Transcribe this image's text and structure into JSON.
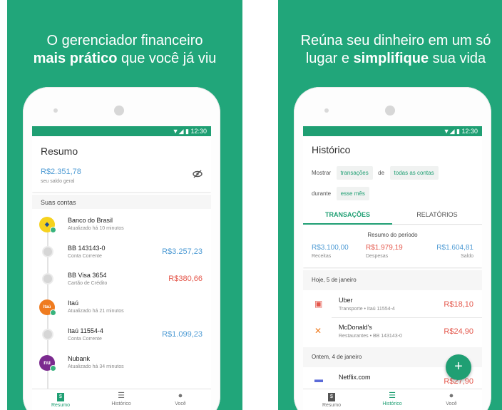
{
  "status_time": "12:30",
  "panel1": {
    "headline_line1": "O gerenciador financeiro",
    "headline_bold": "mais prático",
    "headline_rest": " que você já viu",
    "title": "Resumo",
    "balance": "R$2.351,78",
    "balance_label": "seu saldo geral",
    "section_title": "Suas contas",
    "accounts": [
      {
        "name": "Banco do Brasil",
        "sub": "Atualizado há 10 minutos",
        "amount": ""
      },
      {
        "name": "BB 143143-0",
        "sub": "Conta Corrente",
        "amount": "R$3.257,23"
      },
      {
        "name": "BB Visa 3654",
        "sub": "Cartão de Crédito",
        "amount": "R$380,66"
      },
      {
        "name": "Itaú",
        "sub": "Atualizado há 21 minutos",
        "amount": ""
      },
      {
        "name": "Itaú 11554-4",
        "sub": "Conta Corrente",
        "amount": "R$1.099,23"
      },
      {
        "name": "Nubank",
        "sub": "Atualizado há 34 minutos",
        "amount": ""
      }
    ],
    "logos": {
      "itau": "Itaú",
      "nubank": "nu"
    },
    "nav": [
      "Resumo",
      "Histórico",
      "Você"
    ]
  },
  "panel2": {
    "headline_line1": "Reúna seu dinheiro em um só",
    "headline_pre": "lugar e ",
    "headline_bold": "simplifique",
    "headline_rest": " sua vida",
    "title": "Histórico",
    "filter": {
      "mostrar": "Mostrar",
      "chip1": "transações",
      "de": "de",
      "chip2": "todas as contas",
      "durante": "durante",
      "chip3": "esse mês"
    },
    "tabs": [
      "TRANSAÇÕES",
      "RELATÓRIOS"
    ],
    "period_title": "Resumo do período",
    "receitas_value": "R$3.100,00",
    "receitas_label": "Receitas",
    "despesas_value": "R$1.979,19",
    "despesas_label": "Despesas",
    "saldo_value": "R$1.604,81",
    "saldo_label": "Saldo",
    "day1": "Hoje, 5 de janeiro",
    "transactions": [
      {
        "name": "Uber",
        "sub": "Transporte • Itaú 11554-4",
        "amount": "R$18,10"
      },
      {
        "name": "McDonald's",
        "sub": "Restaurantes • BB 143143-0",
        "amount": "R$24,90"
      }
    ],
    "day2": "Ontem, 4 de janeiro",
    "tx3_name": "Netflix.com",
    "tx3_amount": "R$27,90",
    "fab": "+",
    "nav": [
      "Resumo",
      "Histórico",
      "Você"
    ]
  },
  "colors": {
    "brand": "#21a67a",
    "income": "#4e9bd4",
    "expense": "#e4574b"
  },
  "icons": [
    "eye-off-icon",
    "dollar-icon",
    "list-icon",
    "account-icon",
    "bus-icon",
    "food-icon",
    "credit-card-icon",
    "bank-icon",
    "plus-icon"
  ]
}
